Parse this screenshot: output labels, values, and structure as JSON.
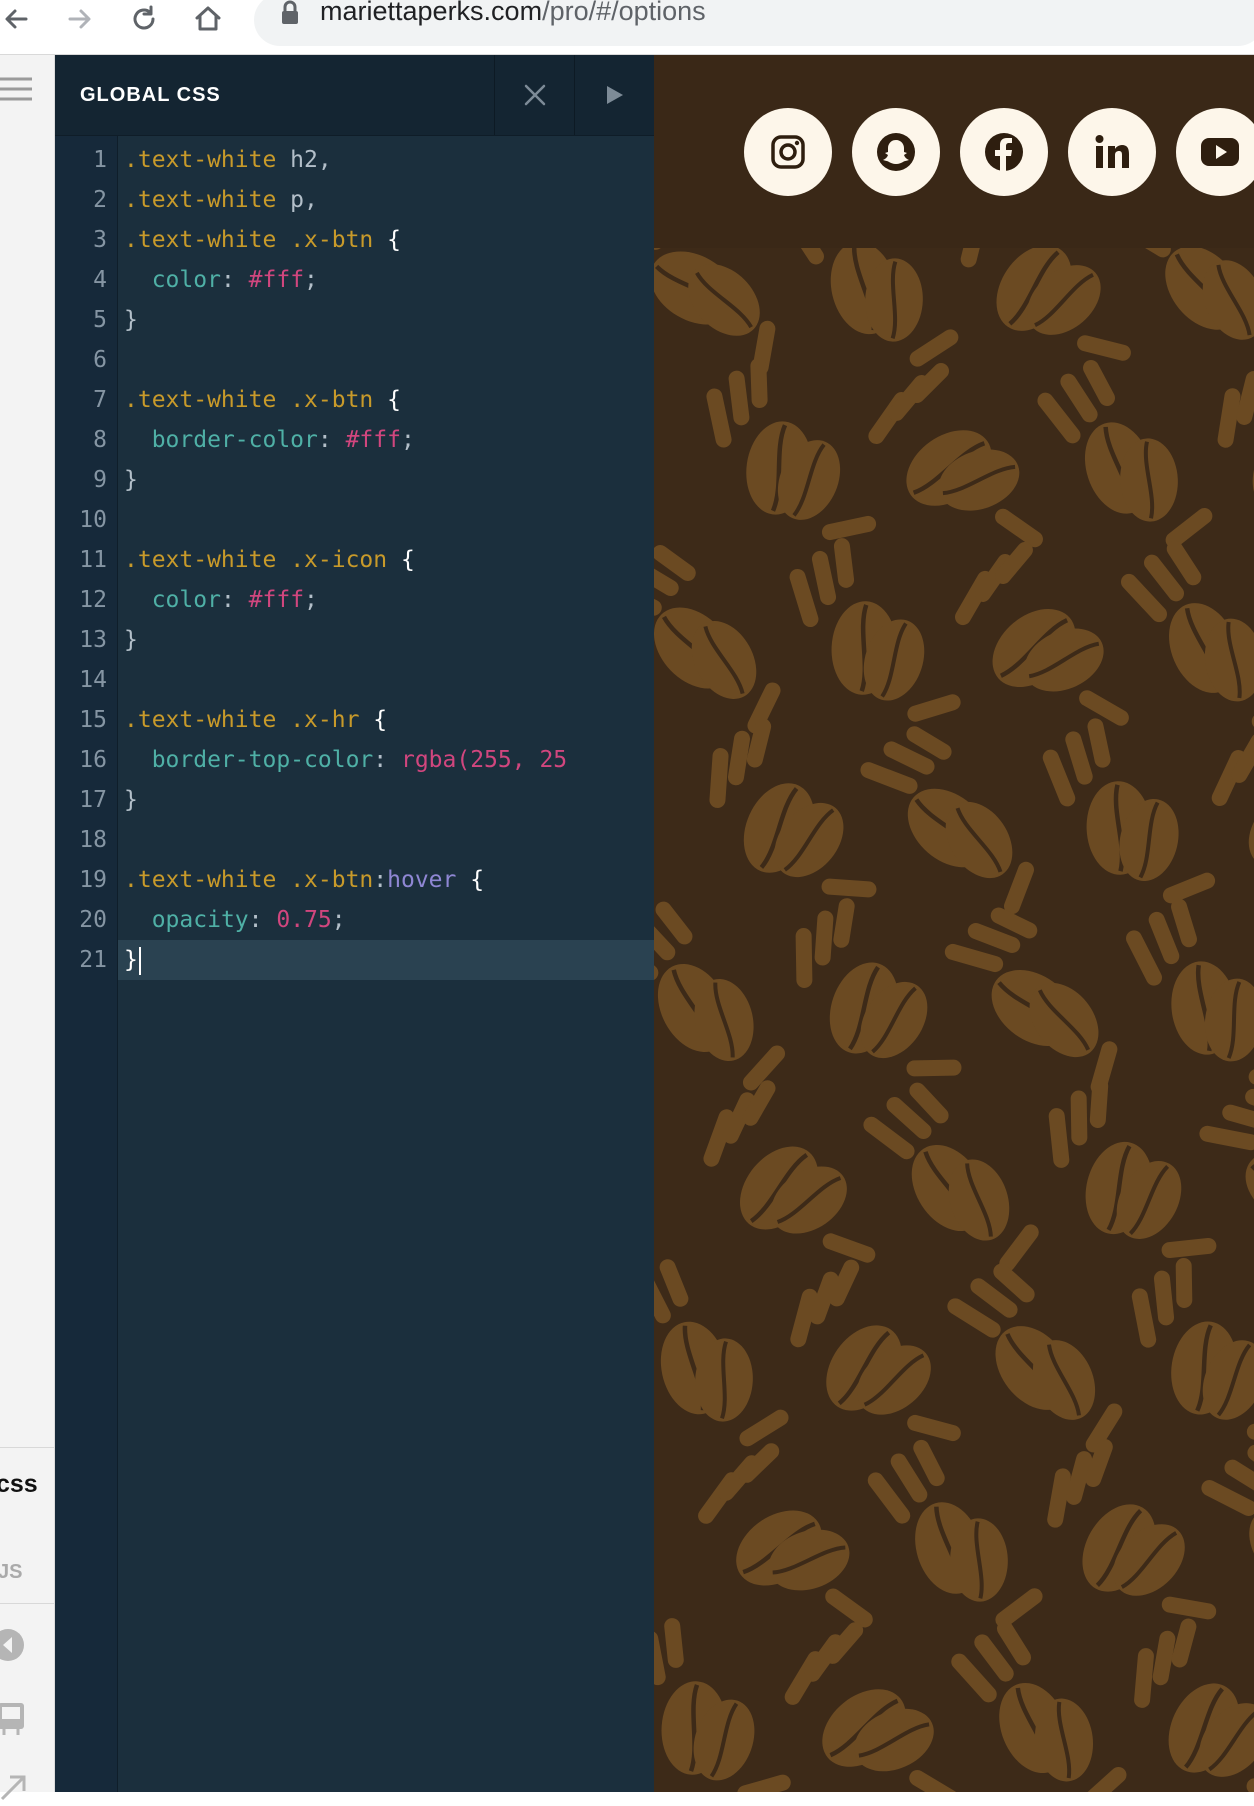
{
  "browser": {
    "url_host": "mariettaperks.com",
    "url_path": "/pro/#/options"
  },
  "left_rail": {
    "tabs": [
      {
        "label": "css"
      },
      {
        "label": "JS"
      }
    ]
  },
  "editor": {
    "title": "GLOBAL CSS",
    "line_numbers": [
      "1",
      "2",
      "3",
      "4",
      "5",
      "6",
      "7",
      "8",
      "9",
      "10",
      "11",
      "12",
      "13",
      "14",
      "15",
      "16",
      "17",
      "18",
      "19",
      "20",
      "21"
    ],
    "lines": [
      ".text-white h2,",
      ".text-white p,",
      ".text-white .x-btn {",
      "  color: #fff;",
      "}",
      "",
      ".text-white .x-btn {",
      "  border-color: #fff;",
      "}",
      "",
      ".text-white .x-icon {",
      "  color: #fff;",
      "}",
      "",
      ".text-white .x-hr {",
      "  border-top-color: rgba(255, 25",
      "}",
      "",
      ".text-white .x-btn:hover {",
      "  opacity: 0.75;",
      "}"
    ],
    "active_line": 21
  },
  "preview": {
    "social_icons": [
      "instagram-icon",
      "snapchat-icon",
      "facebook-icon",
      "linkedin-icon",
      "youtube-icon"
    ],
    "colors": {
      "background": "#3d2a18",
      "pattern": "#6b4a22",
      "button": "#fdf6ea"
    }
  },
  "colors": {
    "editor_bg": "#1b2f3d",
    "selector": "#c89a2a",
    "property": "#4fb0a6",
    "value": "#d1467e",
    "pseudo": "#8f87d4"
  }
}
